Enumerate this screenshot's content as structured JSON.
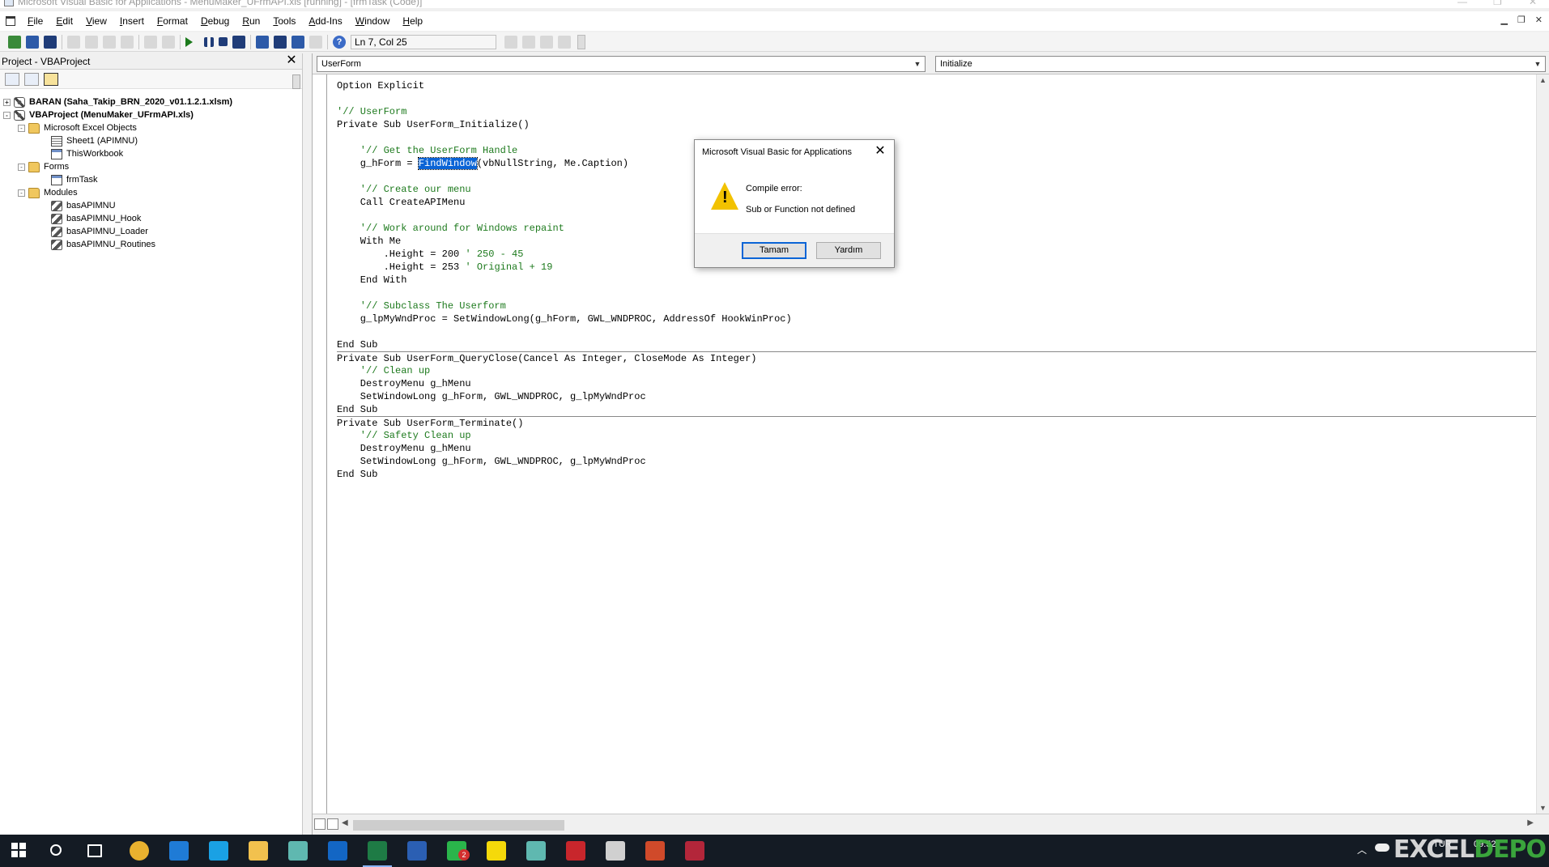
{
  "window": {
    "title": "Microsoft Visual Basic for Applications - MenuMaker_UFrmAPI.xls [running] - [frmTask (Code)]"
  },
  "menu": {
    "items": [
      "File",
      "Edit",
      "View",
      "Insert",
      "Format",
      "Debug",
      "Run",
      "Tools",
      "Add-Ins",
      "Window",
      "Help"
    ]
  },
  "toolbar": {
    "position": "Ln 7, Col 25"
  },
  "project": {
    "title": "Project - VBAProject",
    "tree": [
      {
        "label": "BARAN (Saha_Takip_BRN_2020_v01.1.2.1.xlsm)",
        "expander": "+",
        "icon": "project",
        "level": 0
      },
      {
        "label": "VBAProject (MenuMaker_UFrmAPI.xls)",
        "expander": "-",
        "icon": "project",
        "level": 0
      },
      {
        "label": "Microsoft Excel Objects",
        "expander": "-",
        "icon": "folder",
        "level": 1
      },
      {
        "label": "Sheet1 (APIMNU)",
        "expander": "",
        "icon": "sheet",
        "level": 2
      },
      {
        "label": "ThisWorkbook",
        "expander": "",
        "icon": "workbook",
        "level": 2
      },
      {
        "label": "Forms",
        "expander": "-",
        "icon": "folder",
        "level": 1
      },
      {
        "label": "frmTask",
        "expander": "",
        "icon": "form",
        "level": 2
      },
      {
        "label": "Modules",
        "expander": "-",
        "icon": "folder",
        "level": 1
      },
      {
        "label": "basAPIMNU",
        "expander": "",
        "icon": "module",
        "level": 2
      },
      {
        "label": "basAPIMNU_Hook",
        "expander": "",
        "icon": "module",
        "level": 2
      },
      {
        "label": "basAPIMNU_Loader",
        "expander": "",
        "icon": "module",
        "level": 2
      },
      {
        "label": "basAPIMNU_Routines",
        "expander": "",
        "icon": "module",
        "level": 2
      }
    ]
  },
  "code": {
    "object": "UserForm",
    "procedure": "Initialize",
    "lines": [
      {
        "text": "Option Explicit"
      },
      {
        "text": ""
      },
      {
        "text": "'// UserForm",
        "comment": true
      },
      {
        "text": "Private Sub UserForm_Initialize()"
      },
      {
        "text": ""
      },
      {
        "text": "    '// Get the UserForm Handle",
        "comment": true
      },
      {
        "pre": "    g_hForm = ",
        "hl": "FindWindow",
        "post": "(vbNullString, Me.Caption)"
      },
      {
        "text": ""
      },
      {
        "text": "    '// Create our menu",
        "comment": true
      },
      {
        "text": "    Call CreateAPIMenu"
      },
      {
        "text": ""
      },
      {
        "text": "    '// Work around for Windows repaint",
        "comment": true
      },
      {
        "text": "    With Me"
      },
      {
        "pre": "        .Height = 200 ",
        "cm": "' 250 - 45"
      },
      {
        "pre": "        .Height = 253 ",
        "cm": "' Original + 19"
      },
      {
        "text": "    End With"
      },
      {
        "text": ""
      },
      {
        "text": "    '// Subclass The Userform",
        "comment": true
      },
      {
        "text": "    g_lpMyWndProc = SetWindowLong(g_hForm, GWL_WNDPROC, AddressOf HookWinProc)"
      },
      {
        "text": ""
      },
      {
        "text": "End Sub"
      },
      {
        "text": "Private Sub UserForm_QueryClose(Cancel As Integer, CloseMode As Integer)",
        "sep": true
      },
      {
        "text": "    '// Clean up",
        "comment": true
      },
      {
        "text": "    DestroyMenu g_hMenu"
      },
      {
        "text": "    SetWindowLong g_hForm, GWL_WNDPROC, g_lpMyWndProc"
      },
      {
        "text": "End Sub"
      },
      {
        "text": "Private Sub UserForm_Terminate()",
        "sep": true
      },
      {
        "text": "    '// Safety Clean up",
        "comment": true
      },
      {
        "text": "    DestroyMenu g_hMenu"
      },
      {
        "text": "    SetWindowLong g_hForm, GWL_WNDPROC, g_lpMyWndProc"
      },
      {
        "text": "End Sub"
      }
    ]
  },
  "dialog": {
    "title": "Microsoft Visual Basic for Applications",
    "message_title": "Compile error:",
    "message": "Sub or Function not defined",
    "ok_label": "Tamam",
    "help_label": "Yardım"
  },
  "taskbar": {
    "apps": [
      "chrome",
      "edge",
      "skype",
      "file-explorer",
      "app",
      "outlook",
      "excel",
      "word",
      "whatsapp",
      "sticky-notes",
      "app",
      "download",
      "calculator",
      "powerpoint",
      "access"
    ],
    "lang": "TUR",
    "time": "09:52",
    "badge": "2"
  },
  "watermark": {
    "left": "EXCEL",
    "right": "DEPO"
  },
  "colors": {
    "selection": "#0a64d6",
    "comment": "#1d7a1d",
    "taskbar": "#141b24"
  }
}
